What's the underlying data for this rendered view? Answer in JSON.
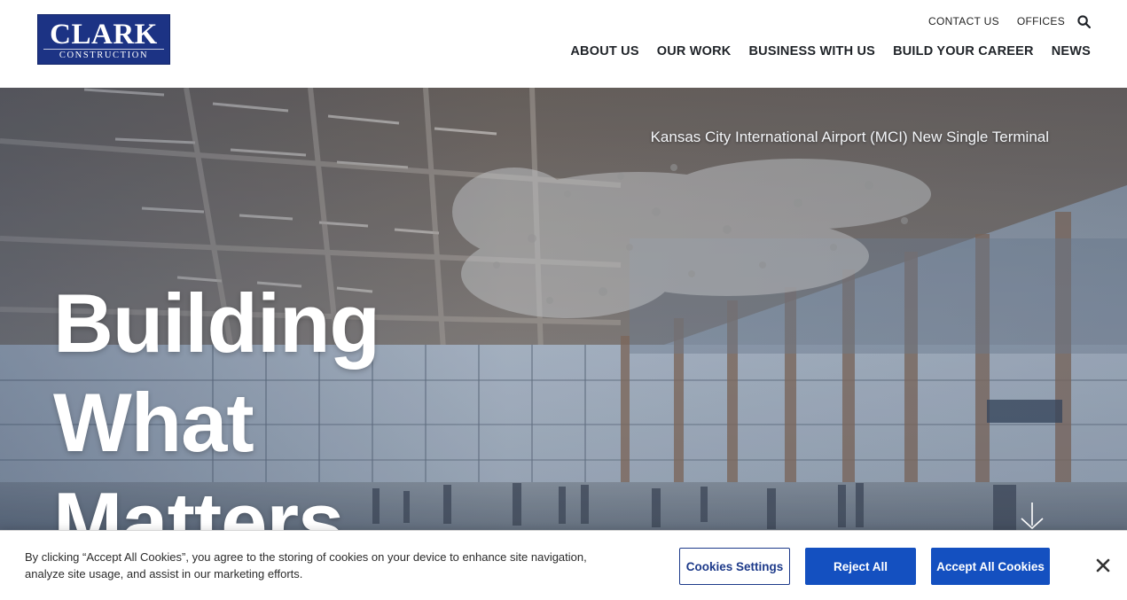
{
  "brand": {
    "logo_main": "CLARK",
    "logo_sub": "CONSTRUCTION",
    "color": "#1c3384"
  },
  "utility_nav": {
    "contact": "CONTACT US",
    "offices": "OFFICES",
    "search_icon": "search-icon"
  },
  "main_nav": {
    "items": [
      {
        "label": "ABOUT US"
      },
      {
        "label": "OUR WORK"
      },
      {
        "label": "BUSINESS WITH US"
      },
      {
        "label": "BUILD YOUR CAREER"
      },
      {
        "label": "NEWS"
      }
    ]
  },
  "hero": {
    "caption": "Kansas City International Airport (MCI) New Single Terminal",
    "headline": [
      "Building",
      "What",
      "Matters"
    ],
    "scroll_icon": "arrow-down-icon"
  },
  "cookie_banner": {
    "text": "By clicking “Accept All Cookies”, you agree to the storing of cookies on your device to enhance site navigation, analyze site usage, and assist in our marketing efforts.",
    "settings_label": "Cookies Settings",
    "reject_label": "Reject All",
    "accept_label": "Accept All Cookies",
    "close_icon": "close-icon",
    "accent_color": "#1450c0"
  }
}
